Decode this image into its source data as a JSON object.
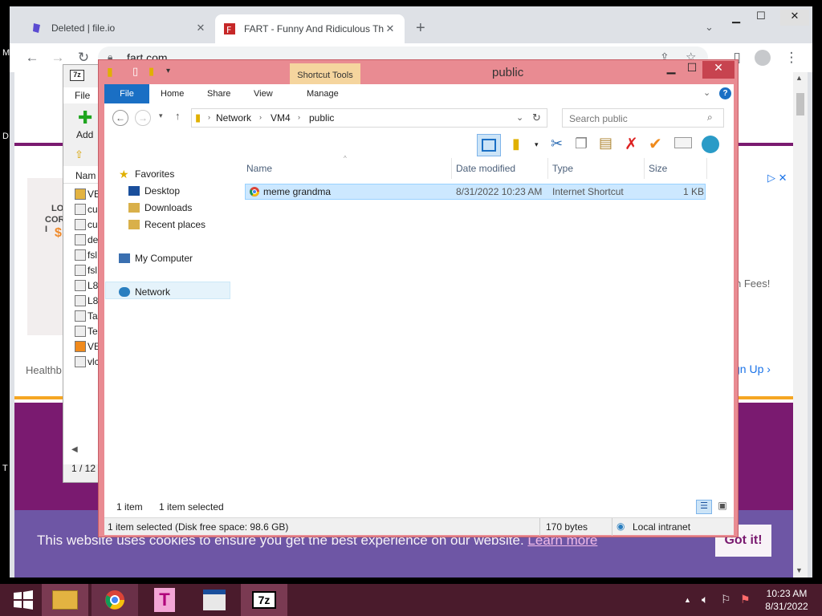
{
  "desktop": {
    "labels": [
      "M",
      "D",
      "T"
    ]
  },
  "browser": {
    "tabs": [
      {
        "title": "Deleted | file.io",
        "close": "✕"
      },
      {
        "title": "FART - Funny And Ridiculous Thi",
        "close": "✕"
      }
    ],
    "new_tab": "+",
    "url": "fart.com",
    "page": {
      "ad_lines": [
        "LO",
        "CORD I",
        "$1"
      ],
      "ad_text_right": "n Fees!",
      "health_text": "Healthb",
      "signup_text": "gn Up",
      "cookie_text": "This website uses cookies to ensure you get the best experience on our website.",
      "learn_more": "Learn more",
      "got_it": "Got it!"
    }
  },
  "sevenzip": {
    "menu_file": "File",
    "add_label": "Add",
    "col_name": "Nam",
    "rows": [
      "VE",
      "cu",
      "cu",
      "de",
      "fsl",
      "fsl",
      "L8",
      "L8",
      "Ta",
      "Te",
      "VE",
      "vlc"
    ],
    "status": "1 / 12"
  },
  "explorer": {
    "title": "public",
    "shortcut_tools": "Shortcut Tools",
    "ribbon_tabs": [
      "File",
      "Home",
      "Share",
      "View",
      "Manage"
    ],
    "breadcrumb": [
      "Network",
      "VM4",
      "public"
    ],
    "search_placeholder": "Search public",
    "nav": {
      "favorites": "Favorites",
      "desktop": "Desktop",
      "downloads": "Downloads",
      "recent": "Recent places",
      "computer": "My Computer",
      "network": "Network"
    },
    "columns": [
      "Name",
      "Date modified",
      "Type",
      "Size"
    ],
    "files": [
      {
        "name": "meme grandma",
        "date": "8/31/2022 10:23 AM",
        "type": "Internet Shortcut",
        "size": "1 KB"
      }
    ],
    "item_count": "1 item",
    "selected_count": "1 item selected",
    "status_selected": "1 item selected (Disk free space: 98.6 GB)",
    "status_bytes": "170 bytes",
    "status_zone": "Local intranet"
  },
  "taskbar": {
    "time": "10:23 AM",
    "date": "8/31/2022"
  },
  "colors": {
    "explorer_frame": "#e98b92",
    "taskbar": "#4a1b2c",
    "page_purple": "#7a1a70",
    "cookie_bar": "#6e5aa8"
  }
}
